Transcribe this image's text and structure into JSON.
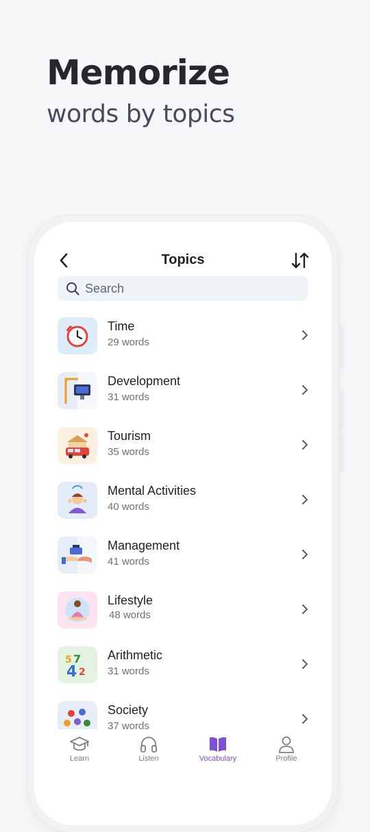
{
  "headline": {
    "title": "Memorize",
    "subtitle": "words by topics"
  },
  "screen": {
    "title": "Topics",
    "search": {
      "placeholder": "Search"
    },
    "topics": [
      {
        "name": "Time",
        "count": "29 words",
        "icon": "alarm-clock-icon"
      },
      {
        "name": "Development",
        "count": "31 words",
        "icon": "crane-computer-icon"
      },
      {
        "name": "Tourism",
        "count": "35 words",
        "icon": "tour-bus-icon"
      },
      {
        "name": "Mental Activities",
        "count": "40 words",
        "icon": "thinking-person-icon"
      },
      {
        "name": "Management",
        "count": "41 words",
        "icon": "briefcase-hands-icon"
      },
      {
        "name": "Lifestyle",
        "count": "48 words",
        "icon": "meditation-icon"
      },
      {
        "name": "Arithmetic",
        "count": "31 words",
        "icon": "numbers-icon"
      },
      {
        "name": "Society",
        "count": "37 words",
        "icon": "people-group-icon"
      }
    ],
    "tabs": [
      {
        "label": "Learn",
        "icon": "graduation-cap-icon",
        "active": false
      },
      {
        "label": "Listen",
        "icon": "headphones-icon",
        "active": false
      },
      {
        "label": "Vocabulary",
        "icon": "book-icon",
        "active": true
      },
      {
        "label": "Profile",
        "icon": "person-icon",
        "active": false
      }
    ]
  },
  "colors": {
    "accent": "#7b4fd6",
    "background": "#f6f7f9",
    "search_bg": "#eef3f8"
  }
}
